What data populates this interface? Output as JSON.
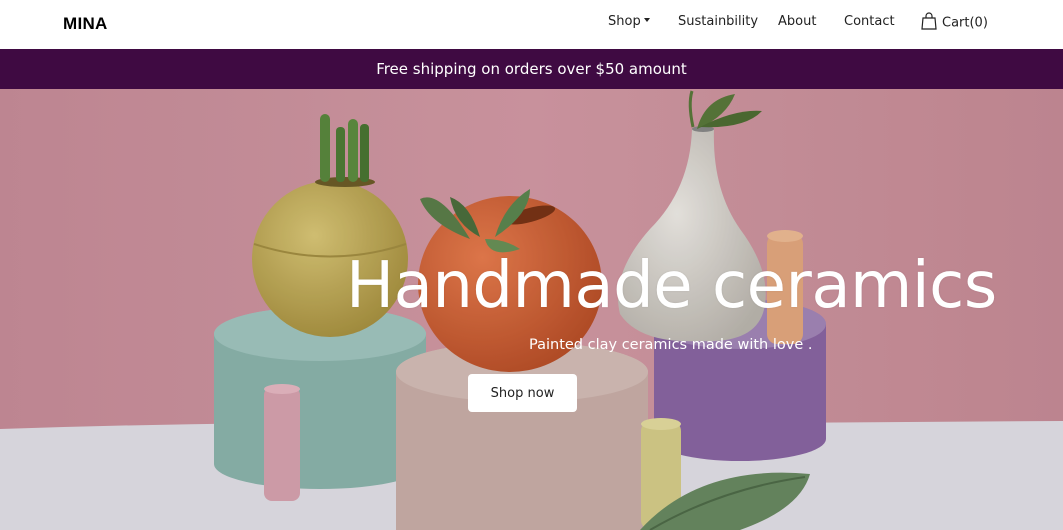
{
  "navbar": {
    "brand": "MINA",
    "items": [
      {
        "label": "Shop",
        "has_dropdown": true
      },
      {
        "label": "Sustainbility"
      },
      {
        "label": "About"
      },
      {
        "label": "Contact"
      }
    ],
    "cart_label": "Cart(0)",
    "cart_icon": "shopping-bag-icon"
  },
  "banner": {
    "text": "Free shipping on orders over $50 amount",
    "background": "#3f0a42"
  },
  "hero": {
    "title": "Handmade ceramics",
    "subtitle": "Painted clay ceramics made with love .",
    "cta_label": "Shop now"
  },
  "colors": {
    "wall_pink": "#cf95a0",
    "floor": "#e4e2e9",
    "yellow_vase": "#c9b35c",
    "orange_vase": "#de6b3e",
    "white_vase": "#e5e2dc",
    "teal_block": "#8fb9b1",
    "beige_block": "#cdb3ad",
    "purple_block": "#8d6aa6"
  }
}
